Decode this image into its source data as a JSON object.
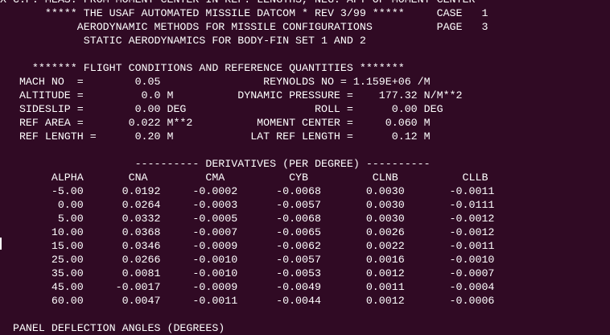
{
  "terminal": {
    "header": {
      "cutoff_line": "X-C.P. MEAS. FROM MOMENT CENTER IN REF. LENGTHS, NEG. AFT OF MOMENT CENTER",
      "program_line": "       ***** THE USAF AUTOMATED MISSILE DATCOM * REV 3/99 *****     CASE   1",
      "methods_line": "            AERODYNAMIC METHODS FOR MISSILE CONFIGURATIONS          PAGE   3",
      "static_line": "             STATIC AERODYNAMICS FOR BODY-FIN SET 1 AND 2"
    },
    "flight_conditions": {
      "title_line": "     ******* FLIGHT CONDITIONS AND REFERENCE QUANTITIES *******",
      "rows": [
        "   MACH NO  =        0.05                REYNOLDS NO = 1.159E+06 /M",
        "   ALTITUDE =         0.0 M          DYNAMIC PRESSURE =    177.32 N/M**2",
        "   SIDESLIP =        0.00 DEG                    ROLL =      0.00 DEG",
        "   REF AREA =       0.022 M**2          MOMENT CENTER =     0.060 M",
        "   REF LENGTH =      0.20 M            LAT REF LENGTH =      0.12 M"
      ]
    },
    "derivatives": {
      "title_line": "                     ---------- DERIVATIVES (PER DEGREE) ----------",
      "header_line": "        ALPHA       CNA         CMA          CYB          CLNB          CLLB",
      "rows": [
        "        -5.00      0.0192     -0.0002      -0.0068       0.0030       -0.0011",
        "         0.00      0.0264     -0.0003      -0.0057       0.0030       -0.0111",
        "         5.00      0.0332     -0.0005      -0.0068       0.0030       -0.0012",
        "        10.00      0.0368     -0.0007      -0.0065       0.0026       -0.0012",
        "        15.00      0.0346     -0.0009      -0.0062       0.0022       -0.0011",
        "        25.00      0.0266     -0.0010      -0.0057       0.0016       -0.0010",
        "        35.00      0.0081     -0.0010      -0.0053       0.0012       -0.0007",
        "        45.00     -0.0017     -0.0009      -0.0049       0.0011       -0.0004",
        "        60.00      0.0047     -0.0011      -0.0044       0.0012       -0.0006"
      ]
    },
    "panel_line": "  PANEL DEFLECTION ANGLES (DEGREES)"
  },
  "colors": {
    "background": "#300a24",
    "text": "#ffffff"
  }
}
